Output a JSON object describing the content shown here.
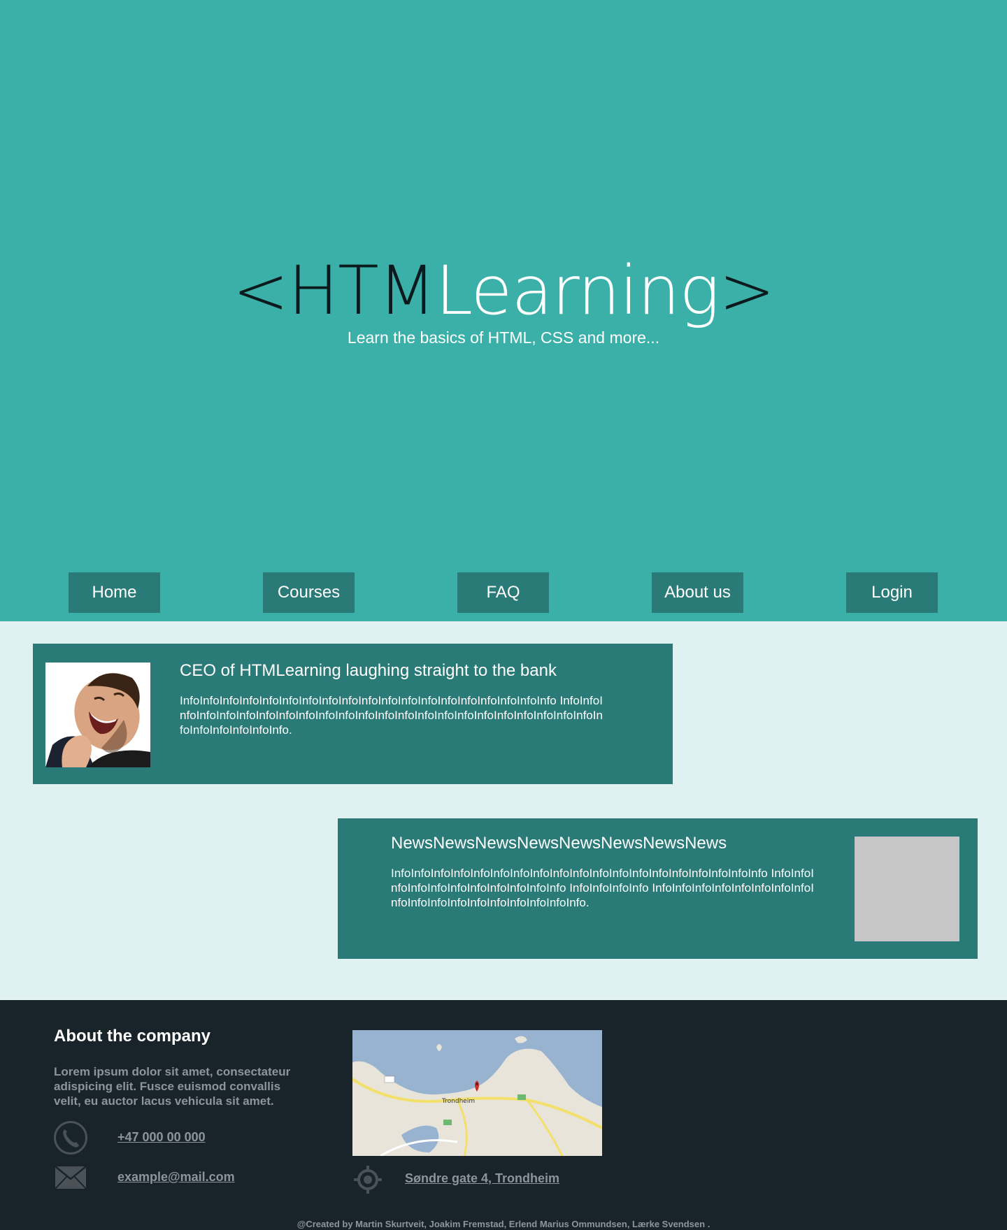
{
  "hero": {
    "logo_open": "<HTM",
    "logo_mid": "Learning",
    "logo_close": ">",
    "tagline": "Learn the basics of HTML, CSS and more..."
  },
  "nav": {
    "items": [
      {
        "label": "Home"
      },
      {
        "label": "Courses"
      },
      {
        "label": "FAQ"
      },
      {
        "label": "About us"
      },
      {
        "label": "Login"
      }
    ]
  },
  "articles": [
    {
      "title": "CEO of HTMLearning laughing straight to the bank",
      "body": "InfoInfoInfoInfoInfoInfoInfoInfoInfoInfoInfoInfoInfoInfoInfoInfoInfoInfoInfo InfoInfoInfoInfoInfoInfoInfoInfoInfoInfoInfoInfoInfoInfoInfoInfoInfoInfoInfoInfoInfoInfoInfoInfoInfoInfoInfoInfoInfo."
    },
    {
      "title": "NewsNewsNewsNewsNewsNewsNewsNews",
      "body": "InfoInfoInfoInfoInfoInfoInfoInfoInfoInfoInfoInfoInfoInfoInfoInfoInfoInfoInfo InfoInfoInfoInfoInfoInfoInfoInfoInfoInfoInfo InfoInfoInfoInfo InfoInfoInfoInfoInfoInfoInfoInfoInfoInfoInfoInfoInfoInfoInfoInfoInfoInfo."
    }
  ],
  "footer": {
    "heading": "About the company",
    "description": "Lorem ipsum dolor sit amet, consectateur adispicing elit. Fusce euismod convallis velit, eu auctor lacus vehicula sit amet.",
    "phone": "+47 000 00 000",
    "email": "example@mail.com",
    "address": "Søndre gate 4, Trondheim",
    "map_label": "Trondheim",
    "credits": "@Created by Martin Skurtveit, Joakim Fremstad, Erlend Marius Ommundsen, Lærke Svendsen ."
  },
  "colors": {
    "hero_bg": "#3bb0a9",
    "accent": "#2a7a77",
    "page_bg": "#dff1f0",
    "footer_bg": "#19232a",
    "footer_text": "#8e959a"
  },
  "icons": [
    "phone-icon",
    "mail-icon",
    "location-icon"
  ]
}
